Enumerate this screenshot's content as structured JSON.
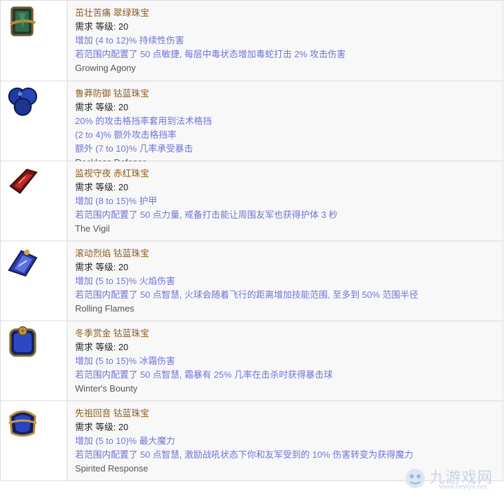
{
  "jewels": [
    {
      "icon": "green-jewel-icon",
      "name": "茁壮苦痛 翠绿珠宝",
      "req": "需求 等级: 20",
      "mods": [
        "增加 (4 to 12)% 持续性伤害",
        "若范围内配置了 50 点敏捷, 每层中毒状态增加毒蛇打击 2% 攻击伤害"
      ],
      "flavor": "Growing Agony"
    },
    {
      "icon": "cobalt-jewel-icon",
      "name": "鲁莽防御 钴蓝珠宝",
      "req": "需求 等级: 20",
      "mods": [
        "20% 的攻击格挡率套用到法术格挡",
        "(2 to 4)% 额外攻击格挡率",
        "额外 (7 to 10)% 几率承受暴击"
      ],
      "flavor": "Reckless Defence"
    },
    {
      "icon": "crimson-jewel-icon",
      "name": "监视守夜 赤红珠宝",
      "req": "需求 等级: 20",
      "mods": [
        "增加 (8 to 15)% 护甲",
        "若范围内配置了 50 点力量, 戒备打击能让周围友军也获得护体 3 秒"
      ],
      "flavor": "The Vigil"
    },
    {
      "icon": "cobalt-jewel-icon",
      "name": "滚动烈焰 钴蓝珠宝",
      "req": "需求 等级: 20",
      "mods": [
        "增加 (5 to 15)% 火焰伤害",
        "若范围内配置了 50 点智慧, 火球会随着飞行的距离增加技能范围, 至多到 50% 范围半径"
      ],
      "flavor": "Rolling Flames"
    },
    {
      "icon": "cobalt-jewel-icon",
      "name": "冬季赏金 钴蓝珠宝",
      "req": "需求 等级: 20",
      "mods": [
        "增加 (5 to 15)% 冰霜伤害",
        "若范围内配置了 50 点智慧, 霜暴有 25% 几率在击杀时获得暴击球"
      ],
      "flavor": "Winter's Bounty"
    },
    {
      "icon": "cobalt-jewel-icon",
      "name": "先祖回音 钴蓝珠宝",
      "req": "需求 等级: 20",
      "mods": [
        "增加 (5 to 10)% 最大魔力",
        "若范围内配置了 50 点智慧, 激励战吼状态下你和友军受到的 10% 伤害转变为获得魔力"
      ],
      "flavor": "Spirited Response"
    }
  ],
  "watermark": {
    "text": "九游戏网",
    "url": "www.newyx.net"
  }
}
